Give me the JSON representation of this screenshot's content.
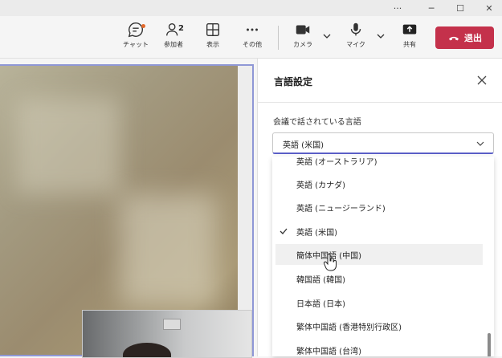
{
  "titlebar": {
    "more": "···",
    "minimize": "─",
    "maximize": "☐",
    "close": "✕"
  },
  "toolbar": {
    "chat_label": "チャット",
    "participants_label": "参加者",
    "participants_count": "2",
    "view_label": "表示",
    "more_label": "その他",
    "camera_label": "カメラ",
    "mic_label": "マイク",
    "share_label": "共有",
    "leave_label": "退出",
    "leave_color": "#c4314b"
  },
  "panel": {
    "title": "言語設定",
    "field_label": "会議で話されている言語",
    "selected_value": "英語 (米国)",
    "options": [
      "英語 (オーストラリア)",
      "英語 (カナダ)",
      "英語 (ニュージーランド)",
      "英語 (米国)",
      "簡体中国語 (中国)",
      "韓国語 (韓国)",
      "日本語 (日本)",
      "繁体中国語 (香港特別行政区)",
      "繁体中国語 (台湾)"
    ],
    "checked_option": "英語 (米国)",
    "hovered_option": "簡体中国語 (中国)"
  }
}
